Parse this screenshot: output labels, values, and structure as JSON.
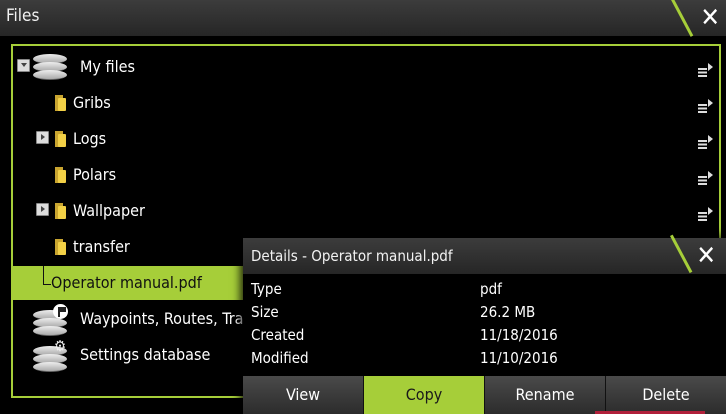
{
  "window": {
    "title": "Files"
  },
  "tree": [
    {
      "label": "My files"
    },
    {
      "label": "Gribs"
    },
    {
      "label": "Logs"
    },
    {
      "label": "Polars"
    },
    {
      "label": "Wallpaper"
    },
    {
      "label": "transfer"
    },
    {
      "label": "Operator manual.pdf"
    },
    {
      "label": "Waypoints, Routes, Track"
    },
    {
      "label": "Settings database"
    }
  ],
  "dialog": {
    "title": "Details - Operator manual.pdf",
    "details": [
      {
        "key": "Type",
        "value": "pdf"
      },
      {
        "key": "Size",
        "value": "26.2 MB"
      },
      {
        "key": "Created",
        "value": "11/18/2016"
      },
      {
        "key": "Modified",
        "value": "11/10/2016"
      }
    ],
    "buttons": [
      {
        "label": "View"
      },
      {
        "label": "Copy"
      },
      {
        "label": "Rename"
      },
      {
        "label": "Delete"
      }
    ]
  },
  "colors": {
    "accent": "#a6ce39",
    "folder": "#f2d046",
    "delete": "#b0203a"
  }
}
